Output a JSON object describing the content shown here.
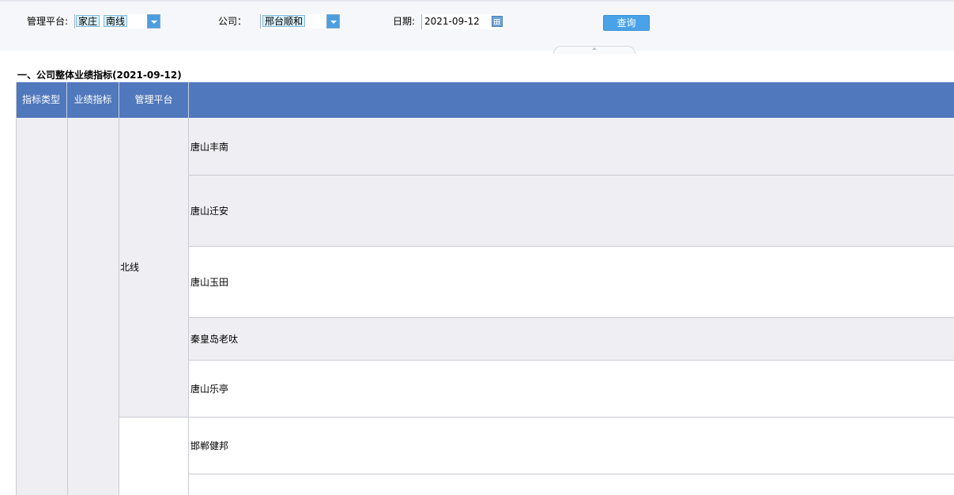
{
  "filters": {
    "platform": {
      "label": "管理平台:",
      "selected_tags": [
        "家庄",
        "南线"
      ]
    },
    "company": {
      "label": "公司：",
      "selected_tags": [
        "邢台顺和"
      ]
    },
    "date": {
      "label": "日期:",
      "value": "2021-09-12"
    },
    "query_label": "查询"
  },
  "section": {
    "title": "一、公司整体业绩指标(2021-09-12)"
  },
  "table": {
    "headers": [
      "指标类型",
      "业绩指标",
      "管理平台",
      ""
    ],
    "groups": [
      {
        "platform": "北线",
        "companies": [
          "唐山丰南",
          "唐山迁安",
          "唐山玉田",
          "秦皇岛老呔",
          "唐山乐亭"
        ]
      },
      {
        "platform": "",
        "companies": [
          "邯郸健邦",
          ""
        ]
      }
    ]
  },
  "colors": {
    "header_bg": "#5078bc",
    "query_button": "#4aa3e8",
    "shaded_row": "#eeeef3"
  }
}
